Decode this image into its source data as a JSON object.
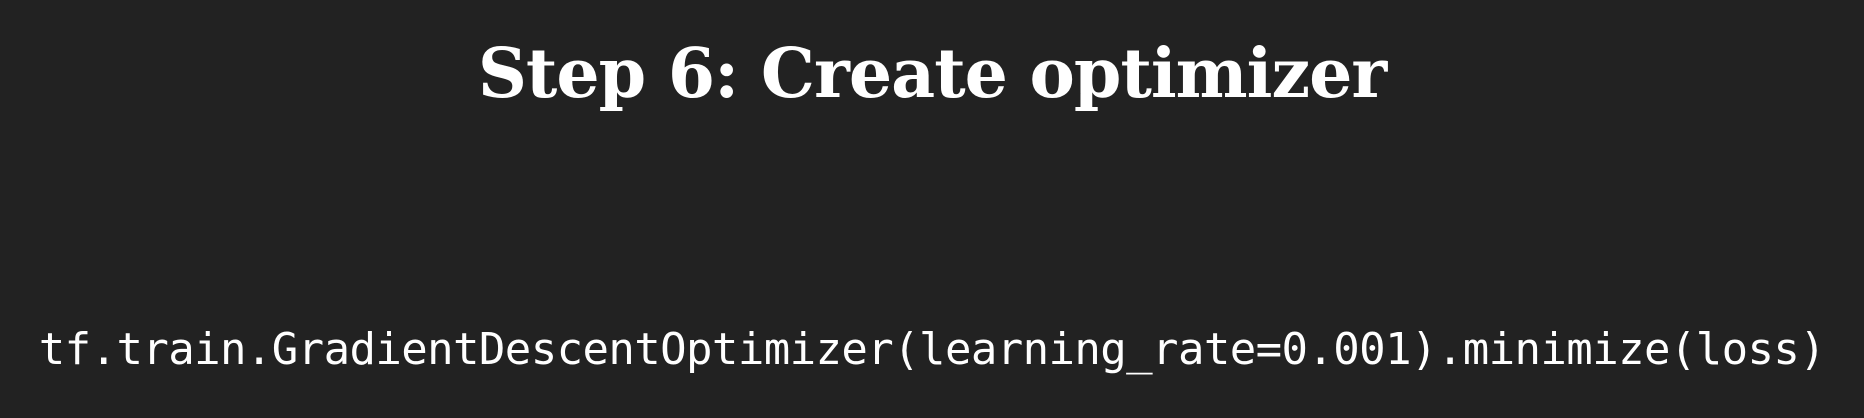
{
  "slide": {
    "title": "Step 6: Create optimizer",
    "code": "tf.train.GradientDescentOptimizer(learning_rate=0.001).minimize(loss)"
  },
  "colors": {
    "background": "#222222",
    "text": "#ffffff"
  }
}
